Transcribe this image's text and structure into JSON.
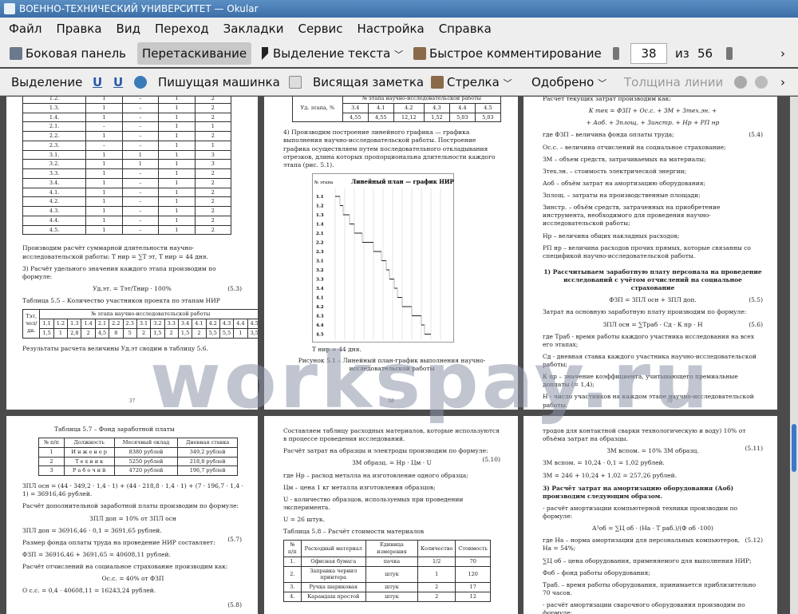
{
  "window": {
    "title": "ВОЕННО-ТЕХНИЧЕСКИЙ УНИВЕРСИТЕТ — Okular"
  },
  "menu": [
    "Файл",
    "Правка",
    "Вид",
    "Переход",
    "Закладки",
    "Сервис",
    "Настройка",
    "Справка"
  ],
  "toolbar1": {
    "sidebar": "Боковая панель",
    "drag": "Перетаскивание",
    "text_select": "Выделение текста",
    "quick_comment": "Быстрое комментирование",
    "page_current": "38",
    "page_of": "из",
    "page_total": "56"
  },
  "toolbar2": {
    "select": "Выделение",
    "typewriter": "Пишущая машинка",
    "sticky": "Висящая заметка",
    "arrow": "Стрелка",
    "approved": "Одобрено",
    "line_width": "Толщина линии"
  },
  "watermark": "workspay.ru",
  "p37": {
    "stage_rows": [
      [
        "1.2.",
        "1",
        "–",
        "1",
        "2"
      ],
      [
        "1.3.",
        "1",
        "–",
        "1",
        "2"
      ],
      [
        "1.4.",
        "1",
        "–",
        "1",
        "2"
      ],
      [
        "2.1.",
        "–",
        "–",
        "1",
        "1"
      ],
      [
        "2.2.",
        "1",
        "–",
        "1",
        "2"
      ],
      [
        "2.3.",
        "–",
        "–",
        "1",
        "1"
      ],
      [
        "3.1.",
        "1",
        "1",
        "1",
        "3"
      ],
      [
        "3.2.",
        "1",
        "1",
        "1",
        "3"
      ],
      [
        "3.3.",
        "1",
        "–",
        "1",
        "2"
      ],
      [
        "3.4.",
        "1",
        "–",
        "1",
        "2"
      ],
      [
        "4.1.",
        "1",
        "–",
        "1",
        "2"
      ],
      [
        "4.2.",
        "1",
        "–",
        "1",
        "2"
      ],
      [
        "4.3.",
        "1",
        "–",
        "1",
        "2"
      ],
      [
        "4.4.",
        "1",
        "–",
        "1",
        "2"
      ],
      [
        "4.5.",
        "1",
        "–",
        "1",
        "2"
      ]
    ],
    "para1": "Производим расчёт суммарной длительности научно-исследовательской работы: Т нир = ∑Т эт, Т нир = 44 дня.",
    "para2": "3) Расчёт удельного значения каждого этапа производим по формуле:",
    "formula": "Уд.эт. = Тэт/Тнир · 100%",
    "formula_no": "(5.3)",
    "table_caption": "Таблица 5.5 – Количество участников проекта по этапам НИР",
    "table_header": "№ этапа научно-исследовательской работы",
    "row_label1": "Тэт, чел/дн.",
    "stages": [
      "1.1",
      "1.2",
      "1.3",
      "1.4",
      "2.1",
      "2.2",
      "2.3",
      "3.1",
      "3.2",
      "3.3",
      "3.4",
      "4.1",
      "4.2",
      "4.3",
      "4.4",
      "4.5"
    ],
    "values": [
      "1,5",
      "1",
      "2,8",
      "2",
      "4,5",
      "8",
      "5",
      "2",
      "1,5",
      "2",
      "1,5",
      "2",
      "5,5",
      "5,5",
      "1",
      "3,5"
    ],
    "para3": "Результаты расчета величины Уд.эт сводим в таблицу 5.6.",
    "page_no": "37"
  },
  "p38": {
    "table_header": "№ этапа научно-исследовательской работы",
    "row_label": "Уд. этапа, %",
    "stages": [
      "3.4",
      "4.1",
      "4.2",
      "4.3",
      "4.4",
      "4.5"
    ],
    "values": [
      "4,55",
      "4,55",
      "12,12",
      "1,52",
      "5,03",
      "5,03"
    ],
    "first_val": "4,55",
    "para1": "4) Производим построение линейного графика — графика выполнения научно-исследовательской работы. Построение графика осуществляем путем последовательного откладывания отрезков, длина которых пропорциональна длительности каждого этапа (рис. 5.1).",
    "chart_title": "Линейный план — график НИР",
    "chart_axis": "№ этапа",
    "chart_stages": [
      "1.1",
      "1.2",
      "1.3",
      "1.4",
      "2.1",
      "2.2",
      "2.3",
      "3.1",
      "3.2",
      "3.3",
      "3.4",
      "4.1",
      "4.2",
      "4.3",
      "4.4",
      "4.5"
    ],
    "total": "Т нир = 44 дня.",
    "caption": "Рисунок 5.1 – Линейный план-график выполнения научно-исследовательской работы",
    "page_no": "38"
  },
  "p39": {
    "lines": [
      "Расчет текущих затрат производим как:",
      "К тек = ФЗП + Ос.с. + ЗМ + Зтех.эн. +",
      "+ Аоб. + Зплощ. + Зинстр. + Нр + РП нр",
      "где ФЗП – величина фонда оплаты труда;",
      "Ос.с. – величина отчислений на социальное страхование;",
      "ЗМ – объем средств, затрачиваемых на материалы;",
      "Зтех.эн. – стоимость электрической энергии;",
      "Аоб – объём затрат на амортизацию оборудования;",
      "Зплощ. – затраты на производственные площади;",
      "Зинстр. – объём средств, затраченных на приобретение инструмента, необходимого для проведения научно-исследовательской работы;",
      "Нр – величина общих накладных расходов;",
      "РП нр – величина расходов прочих прямых, которые связанны со спецификой научно-исследовательской работы."
    ],
    "formula_no": "(5.4)",
    "heading": "1) Рассчитываем заработную плату персонала на проведение исследований с учётом отчислений на социальное страхование",
    "f55": "ФЗП = ЗПЛ осн + ЗПЛ доп.",
    "f55_no": "(5.5)",
    "para2": "Затрат на основную заработную плату производим по формуле:",
    "f56": "ЗПЛ осн = ∑Траб · Сд · К пр · Н",
    "f56_no": "(5.6)",
    "lines2": [
      "где Траб - время работы каждого участника исследования на всех его этапах;",
      "Сд - дневная ставка каждого участника научно-исследовательской работы;",
      "К пр – значение коэффициента, учитывающего премиальные доплаты (= 1,4);",
      "Н - число участников на каждом этапе научно-исследовательской работы."
    ],
    "page_no": "39"
  },
  "p40": {
    "caption": "Таблица 5.7 – Фонд заработной платы",
    "headers": [
      "№ п/п",
      "Должность",
      "Месячный оклад",
      "Дневная ставка"
    ],
    "rows": [
      [
        "1",
        "И н ж е н е р",
        "8380 рублей",
        "349,2 рублей"
      ],
      [
        "2",
        "Т е х н и к",
        "5250 рублей",
        "218,8 рублей"
      ],
      [
        "3",
        "Р а б о ч и й",
        "4720 рублей",
        "196,7 рублей"
      ]
    ],
    "lines": [
      "ЗПЛ осн = (44 · 349,2 · 1,4 · 1) + (44 · 218,8 · 1,4 · 1) + (7 · 196,7 · 1,4 · 1) = 36916,46 рублей.",
      "Расчёт дополнительной заработной платы производим по формуле:",
      "ЗПЛ доп = 10% от ЗПЛ осн",
      "ЗПЛ доп = 36916,46 · 0,1 = 3691,65 рублей.",
      "Размер фонда оплаты труда на проведение НИР составляет:",
      "ФЗП = 36916,46 + 3691,65 = 40608,11 рублей.",
      "Расчёт отчислений на социальное страхование производим как:",
      "Ос.с. = 40% от ФЗП",
      "О с.с. = 0,4 · 40608,11 = 16243,24 рублей."
    ],
    "f57_no": "(5.7)",
    "f58_no": "(5.8)"
  },
  "p41": {
    "lines": [
      "Составляем таблицу расходных материалов, которые используются в процессе проведения исследований.",
      "Расчёт затрат на образцы и электроды производим по формуле:",
      "ЗМ образц. = Нр · Цм · U",
      "где Нр – расход металла на изготовление одного образца;",
      "Цм – цена 1 кг металла изготовления образцов;",
      "U - количество образцов, используемых при проведении эксперимента.",
      "U = 26 штук.",
      "Таблица 5.8 – Расчёт стоимости материалов"
    ],
    "f510_no": "(5.10)",
    "headers": [
      "№ п/п",
      "Расходный материал",
      "Единица измерения",
      "Количество",
      "Стоимость"
    ],
    "rows": [
      [
        "1.",
        "Офисная бумага",
        "пачка",
        "1/2",
        "70"
      ],
      [
        "2.",
        "Заправка чернил принтера",
        "штук",
        "1",
        "120"
      ],
      [
        "3.",
        "Ручка шариковая",
        "штук",
        "2",
        "17"
      ],
      [
        "4.",
        "Карандаш простой",
        "штук",
        "2",
        "12"
      ]
    ]
  },
  "p42": {
    "lines": [
      "тродов для контактной сварки технологическую и воду) 10% от объёма затрат на образцы.",
      "ЗМ вспом. = 10% ЗМ образц.",
      "ЗМ вспом. = 10,24 · 0,1 = 1,02 рублей.",
      "ЗМ = 246 + 10,24 + 1,02 = 257,26 рублей."
    ],
    "f511_no": "(5.11)",
    "heading": "3) Расчёт затрат на амортизацию оборудования (Аоб) производим следующим образом.",
    "lines2": [
      "- расчёт амортизации компьютерной техники производим по формуле:",
      "где На – норма амортизации для персональных компьютеров, На = 54%;",
      "∑Ц об – цена оборудования, применяемого для выполнения НИР;",
      "Фоб – фонд работы оборудования;",
      "Траб. – время работы оборудования, принимается приблизительно 70 часов.",
      "- расчёт амортизации сварочного оборудования производим по формуле:"
    ],
    "f512": "А¹об = ∑Ц об · (На · Т раб.)/(Ф об ·100)",
    "f512_no": "(5.12)",
    "f513": "А²об = ∑Ц об · (На · Т исп.)/(Ф об ·100)",
    "f513_no": "(5.13)"
  }
}
